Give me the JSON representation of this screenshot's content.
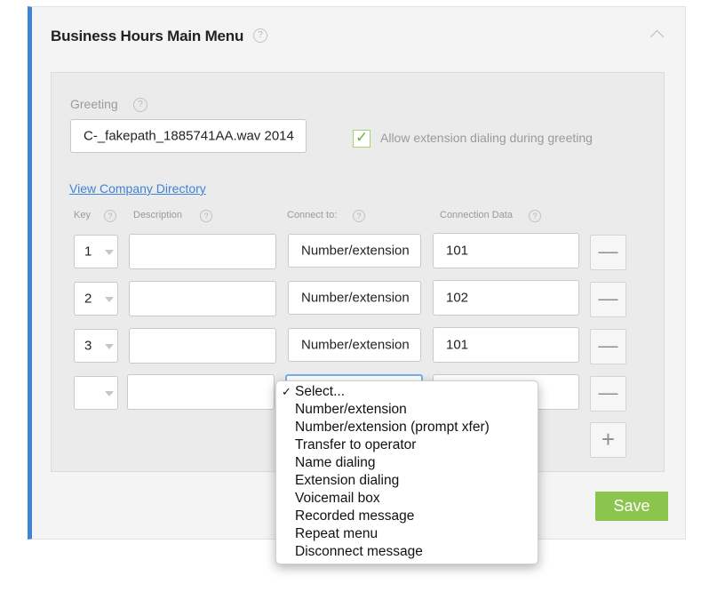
{
  "panel": {
    "title": "Business Hours Main Menu",
    "help_glyph": "?"
  },
  "greeting": {
    "label": "Greeting",
    "value": "C-_fakepath_1885741AA.wav 2014"
  },
  "allow_extension": {
    "checked": true,
    "check_glyph": "✓",
    "label": "Allow extension dialing during greeting"
  },
  "directory_link": "View Company Directory",
  "columns": {
    "key": "Key",
    "description": "Description",
    "connect_to": "Connect to:",
    "connection_data": "Connection Data"
  },
  "rows": [
    {
      "key": "1",
      "description": "",
      "connect_to": "Number/extension",
      "connection_data": "101"
    },
    {
      "key": "2",
      "description": "",
      "connect_to": "Number/extension",
      "connection_data": "102"
    },
    {
      "key": "3",
      "description": "",
      "connect_to": "Number/extension",
      "connection_data": "101"
    },
    {
      "key": "",
      "description": "",
      "connect_to": "",
      "connection_data": ""
    }
  ],
  "remove_glyph": "—",
  "add_glyph": "+",
  "save_label": "Save",
  "connect_options": [
    "Select...",
    "Number/extension",
    "Number/extension (prompt xfer)",
    "Transfer to operator",
    "Name dialing",
    "Extension dialing",
    "Voicemail box",
    "Recorded message",
    "Repeat menu",
    "Disconnect message"
  ],
  "selected_option": "Select...",
  "selected_check": "✓",
  "colors": {
    "accent": "#3d84d6",
    "save": "#8cc54e",
    "check": "#6cb43a"
  }
}
